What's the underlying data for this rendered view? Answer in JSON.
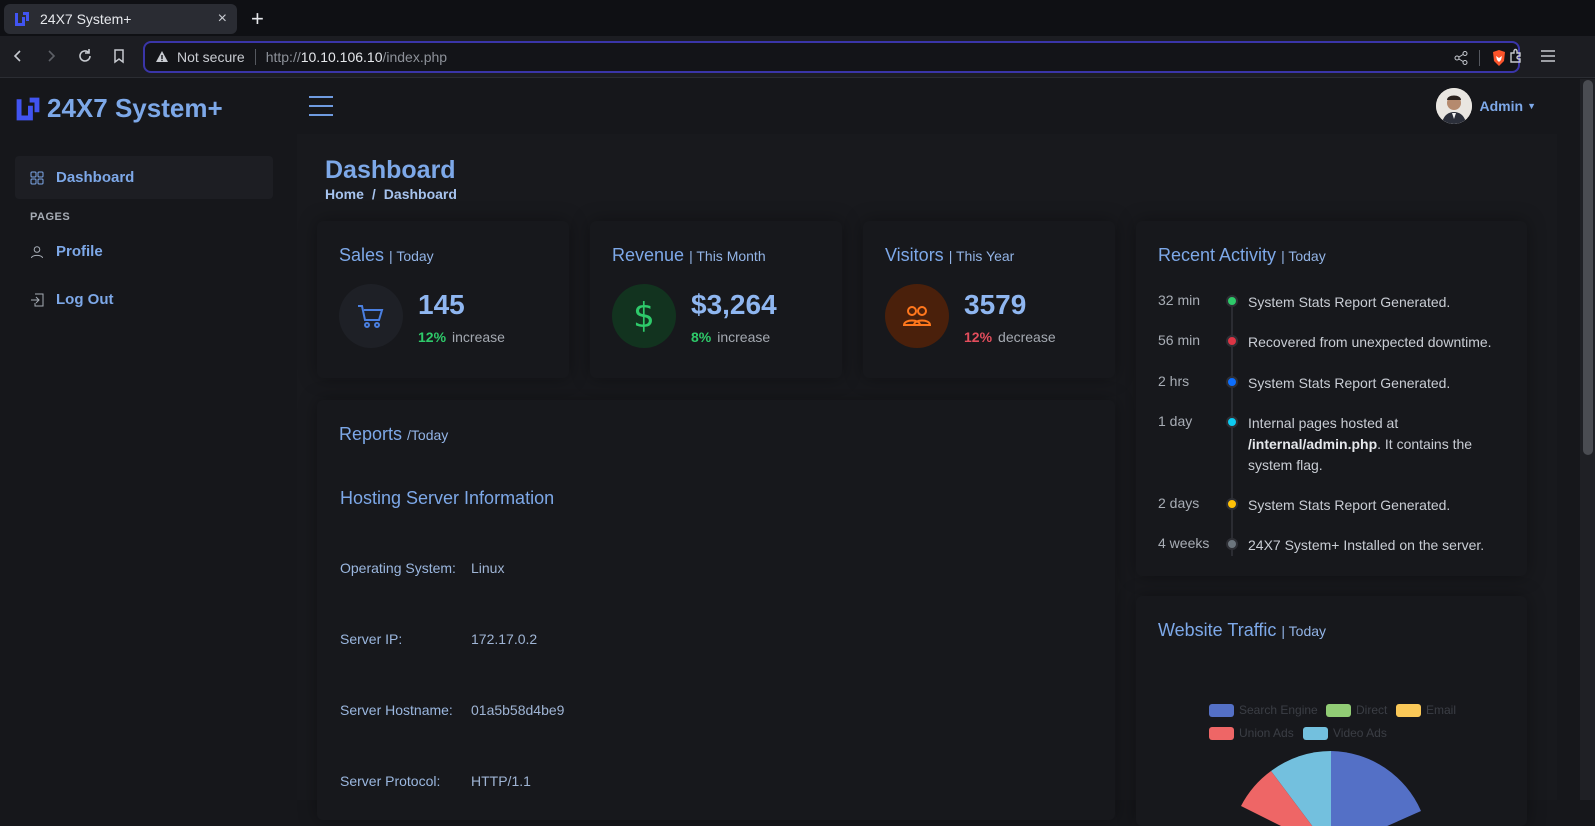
{
  "browser": {
    "tab_title": "24X7 System+",
    "tab_close": "×",
    "new_tab": "+",
    "security_label": "Not secure",
    "url_prefix": "http://",
    "url_host": "10.10.106.10",
    "url_path": "/index.php"
  },
  "app": {
    "brand": "24X7 System+",
    "user_name": "Admin",
    "colors": {
      "accent": "#7da8e8",
      "success": "#2eca6a",
      "danger": "#e34d5c",
      "orange": "#ff771d"
    }
  },
  "sidebar": {
    "items": [
      {
        "label": "Dashboard",
        "icon": "grid-icon",
        "active": true
      },
      {
        "label": "Profile",
        "icon": "person-icon"
      },
      {
        "label": "Log Out",
        "icon": "box-arrow-in-right-icon"
      }
    ],
    "heading": "PAGES"
  },
  "page": {
    "title": "Dashboard",
    "breadcrumb": [
      "Home",
      "Dashboard"
    ],
    "breadcrumb_sep": "/"
  },
  "stats": [
    {
      "title": "Sales",
      "period": "| Today",
      "value": "145",
      "change_pct": "12%",
      "change_word": "increase",
      "icon": "cart-icon"
    },
    {
      "title": "Revenue",
      "period": "| This Month",
      "value": "$3,264",
      "change_pct": "8%",
      "change_word": "increase",
      "icon": "currency-dollar-icon"
    },
    {
      "title": "Visitors",
      "period": "| This Year",
      "value": "3579",
      "change_pct": "12%",
      "change_word": "decrease",
      "icon": "people-icon"
    }
  ],
  "reports": {
    "title": "Reports",
    "period": "/Today",
    "section_title": "Hosting Server Information",
    "rows": [
      {
        "label": "Operating System:",
        "value": "Linux"
      },
      {
        "label": "Server IP:",
        "value": "172.17.0.2"
      },
      {
        "label": "Server Hostname:",
        "value": "01a5b58d4be9"
      },
      {
        "label": "Server Protocol:",
        "value": "HTTP/1.1"
      }
    ]
  },
  "activity": {
    "title": "Recent Activity",
    "period": "| Today",
    "items": [
      {
        "time": "32 min",
        "text": "System Stats Report Generated.",
        "color": "#2eca6a"
      },
      {
        "time": "56 min",
        "text": "Recovered from unexpected downtime.",
        "color": "#dc3545"
      },
      {
        "time": "2 hrs",
        "text": "System Stats Report Generated.",
        "color": "#0d6efd"
      },
      {
        "time": "1 day",
        "text_before": "Internal pages hosted at ",
        "text_bold": "/internal/admin.php",
        "text_after": ". It contains the system flag.",
        "color": "#0dcaf0"
      },
      {
        "time": "2 days",
        "text": "System Stats Report Generated.",
        "color": "#ffc107"
      },
      {
        "time": "4 weeks",
        "text": "24X7 System+ Installed on the server.",
        "color": "#6c757d"
      }
    ]
  },
  "traffic": {
    "title": "Website Traffic",
    "period": "| Today",
    "legend": [
      {
        "label": "Search Engine",
        "color": "#5470c6"
      },
      {
        "label": "Direct",
        "color": "#91cc75"
      },
      {
        "label": "Email",
        "color": "#fac858"
      },
      {
        "label": "Union Ads",
        "color": "#ee6666"
      },
      {
        "label": "Video Ads",
        "color": "#73c0de"
      }
    ]
  }
}
